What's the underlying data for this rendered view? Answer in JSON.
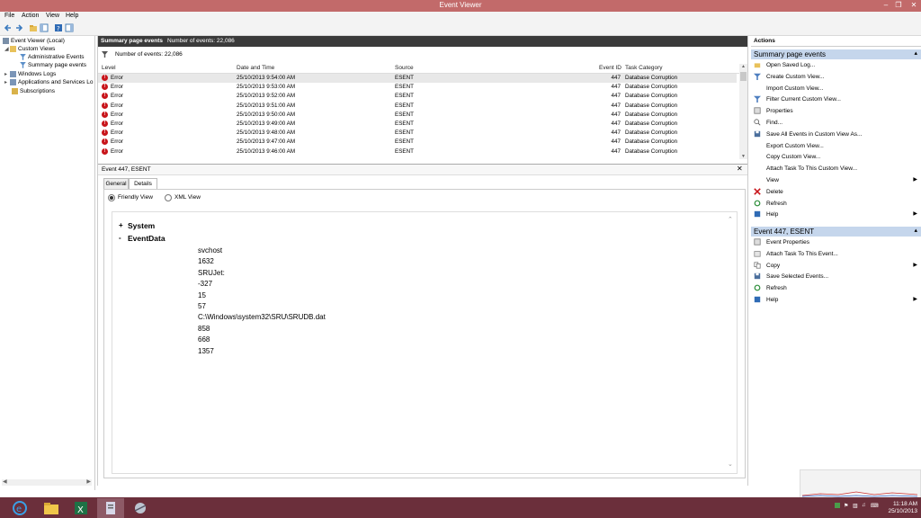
{
  "window": {
    "title": "Event Viewer"
  },
  "menu": [
    "File",
    "Action",
    "View",
    "Help"
  ],
  "tree": [
    {
      "label": "Event Viewer (Local)",
      "indent": 0
    },
    {
      "label": "Custom Views",
      "indent": 1
    },
    {
      "label": "Administrative Events",
      "indent": 2
    },
    {
      "label": "Summary page events",
      "indent": 2
    },
    {
      "label": "Windows Logs",
      "indent": 1
    },
    {
      "label": "Applications and Services Lo",
      "indent": 1
    },
    {
      "label": "Subscriptions",
      "indent": 1
    }
  ],
  "summary": {
    "title": "Summary page events",
    "count_label": "Number of events: 22,086"
  },
  "filter": {
    "label": "Number of events: 22,086"
  },
  "columns": {
    "level": "Level",
    "datetime": "Date and Time",
    "source": "Source",
    "event_id": "Event ID",
    "task": "Task Category"
  },
  "events": [
    {
      "level": "Error",
      "datetime": "25/10/2013 9:54:00 AM",
      "source": "ESENT",
      "event_id": "447",
      "task": "Database Corruption"
    },
    {
      "level": "Error",
      "datetime": "25/10/2013 9:53:00 AM",
      "source": "ESENT",
      "event_id": "447",
      "task": "Database Corruption"
    },
    {
      "level": "Error",
      "datetime": "25/10/2013 9:52:00 AM",
      "source": "ESENT",
      "event_id": "447",
      "task": "Database Corruption"
    },
    {
      "level": "Error",
      "datetime": "25/10/2013 9:51:00 AM",
      "source": "ESENT",
      "event_id": "447",
      "task": "Database Corruption"
    },
    {
      "level": "Error",
      "datetime": "25/10/2013 9:50:00 AM",
      "source": "ESENT",
      "event_id": "447",
      "task": "Database Corruption"
    },
    {
      "level": "Error",
      "datetime": "25/10/2013 9:49:00 AM",
      "source": "ESENT",
      "event_id": "447",
      "task": "Database Corruption"
    },
    {
      "level": "Error",
      "datetime": "25/10/2013 9:48:00 AM",
      "source": "ESENT",
      "event_id": "447",
      "task": "Database Corruption"
    },
    {
      "level": "Error",
      "datetime": "25/10/2013 9:47:00 AM",
      "source": "ESENT",
      "event_id": "447",
      "task": "Database Corruption"
    },
    {
      "level": "Error",
      "datetime": "25/10/2013 9:46:00 AM",
      "source": "ESENT",
      "event_id": "447",
      "task": "Database Corruption"
    }
  ],
  "detail": {
    "title": "Event 447, ESENT",
    "tabs": [
      "General",
      "Details"
    ],
    "views": [
      "Friendly View",
      "XML View"
    ],
    "sections": [
      {
        "toggle": "+",
        "label": "System"
      },
      {
        "toggle": "-",
        "label": "EventData"
      }
    ],
    "event_data": [
      "svchost",
      "1632",
      "SRUJet:",
      "-327",
      "15",
      "57",
      "C:\\Windows\\system32\\SRU\\SRUDB.dat",
      "858",
      "668",
      "1357"
    ]
  },
  "actions": {
    "header": "Actions",
    "group1_title": "Summary page events",
    "group1": [
      {
        "label": "Open Saved Log...",
        "icon": "folder-icon",
        "submenu": false
      },
      {
        "label": "Create Custom View...",
        "icon": "filter-icon",
        "submenu": false
      },
      {
        "label": "Import Custom View...",
        "icon": "",
        "submenu": false
      },
      {
        "label": "Filter Current Custom View...",
        "icon": "filter-icon",
        "submenu": false
      },
      {
        "label": "Properties",
        "icon": "properties-icon",
        "submenu": false
      },
      {
        "label": "Find...",
        "icon": "find-icon",
        "submenu": false
      },
      {
        "label": "Save All Events in Custom View As...",
        "icon": "save-icon",
        "submenu": false
      },
      {
        "label": "Export Custom View...",
        "icon": "",
        "submenu": false
      },
      {
        "label": "Copy Custom View...",
        "icon": "",
        "submenu": false
      },
      {
        "label": "Attach Task To This Custom View...",
        "icon": "",
        "submenu": false
      },
      {
        "label": "View",
        "icon": "",
        "submenu": true
      },
      {
        "label": "Delete",
        "icon": "delete-icon",
        "submenu": false
      },
      {
        "label": "Refresh",
        "icon": "refresh-icon",
        "submenu": false
      },
      {
        "label": "Help",
        "icon": "help-icon",
        "submenu": true
      }
    ],
    "group2_title": "Event 447, ESENT",
    "group2": [
      {
        "label": "Event Properties",
        "icon": "properties-icon",
        "submenu": false
      },
      {
        "label": "Attach Task To This Event...",
        "icon": "task-icon",
        "submenu": false
      },
      {
        "label": "Copy",
        "icon": "copy-icon",
        "submenu": true
      },
      {
        "label": "Save Selected Events...",
        "icon": "save-icon",
        "submenu": false
      },
      {
        "label": "Refresh",
        "icon": "refresh-icon",
        "submenu": false
      },
      {
        "label": "Help",
        "icon": "help-icon",
        "submenu": true
      }
    ]
  },
  "taskbar": {
    "time": "11:18 AM",
    "date": "25/10/2013"
  },
  "colors": {
    "titlebar": "#c26a6a",
    "taskbar": "#6b2f3b",
    "error": "#c8151b",
    "accent": "#c5d6ec"
  }
}
